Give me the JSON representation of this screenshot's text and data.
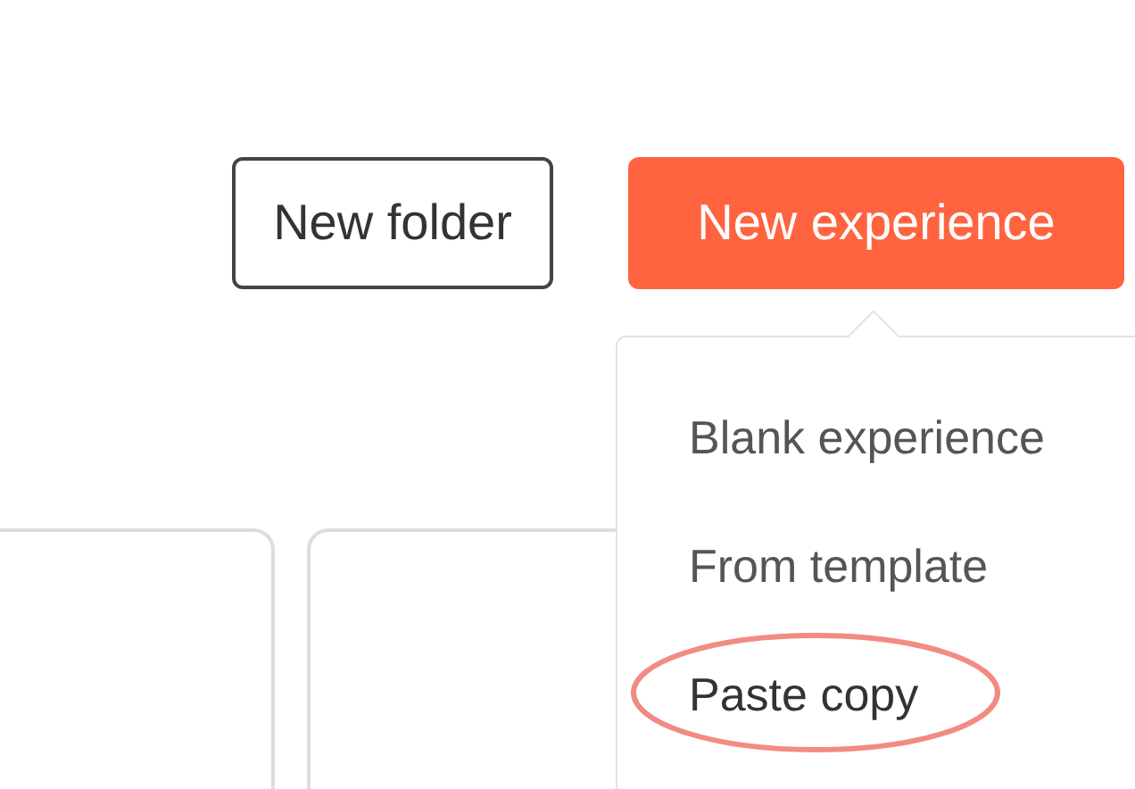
{
  "toolbar": {
    "buttons": [
      {
        "label": "New folder",
        "kind": "outline"
      },
      {
        "label": "New experience",
        "kind": "primary"
      }
    ]
  },
  "menu": {
    "items": [
      {
        "label": "Blank experience",
        "highlighted": false
      },
      {
        "label": "From template",
        "highlighted": false
      },
      {
        "label": "Paste copy",
        "highlighted": true
      }
    ]
  }
}
